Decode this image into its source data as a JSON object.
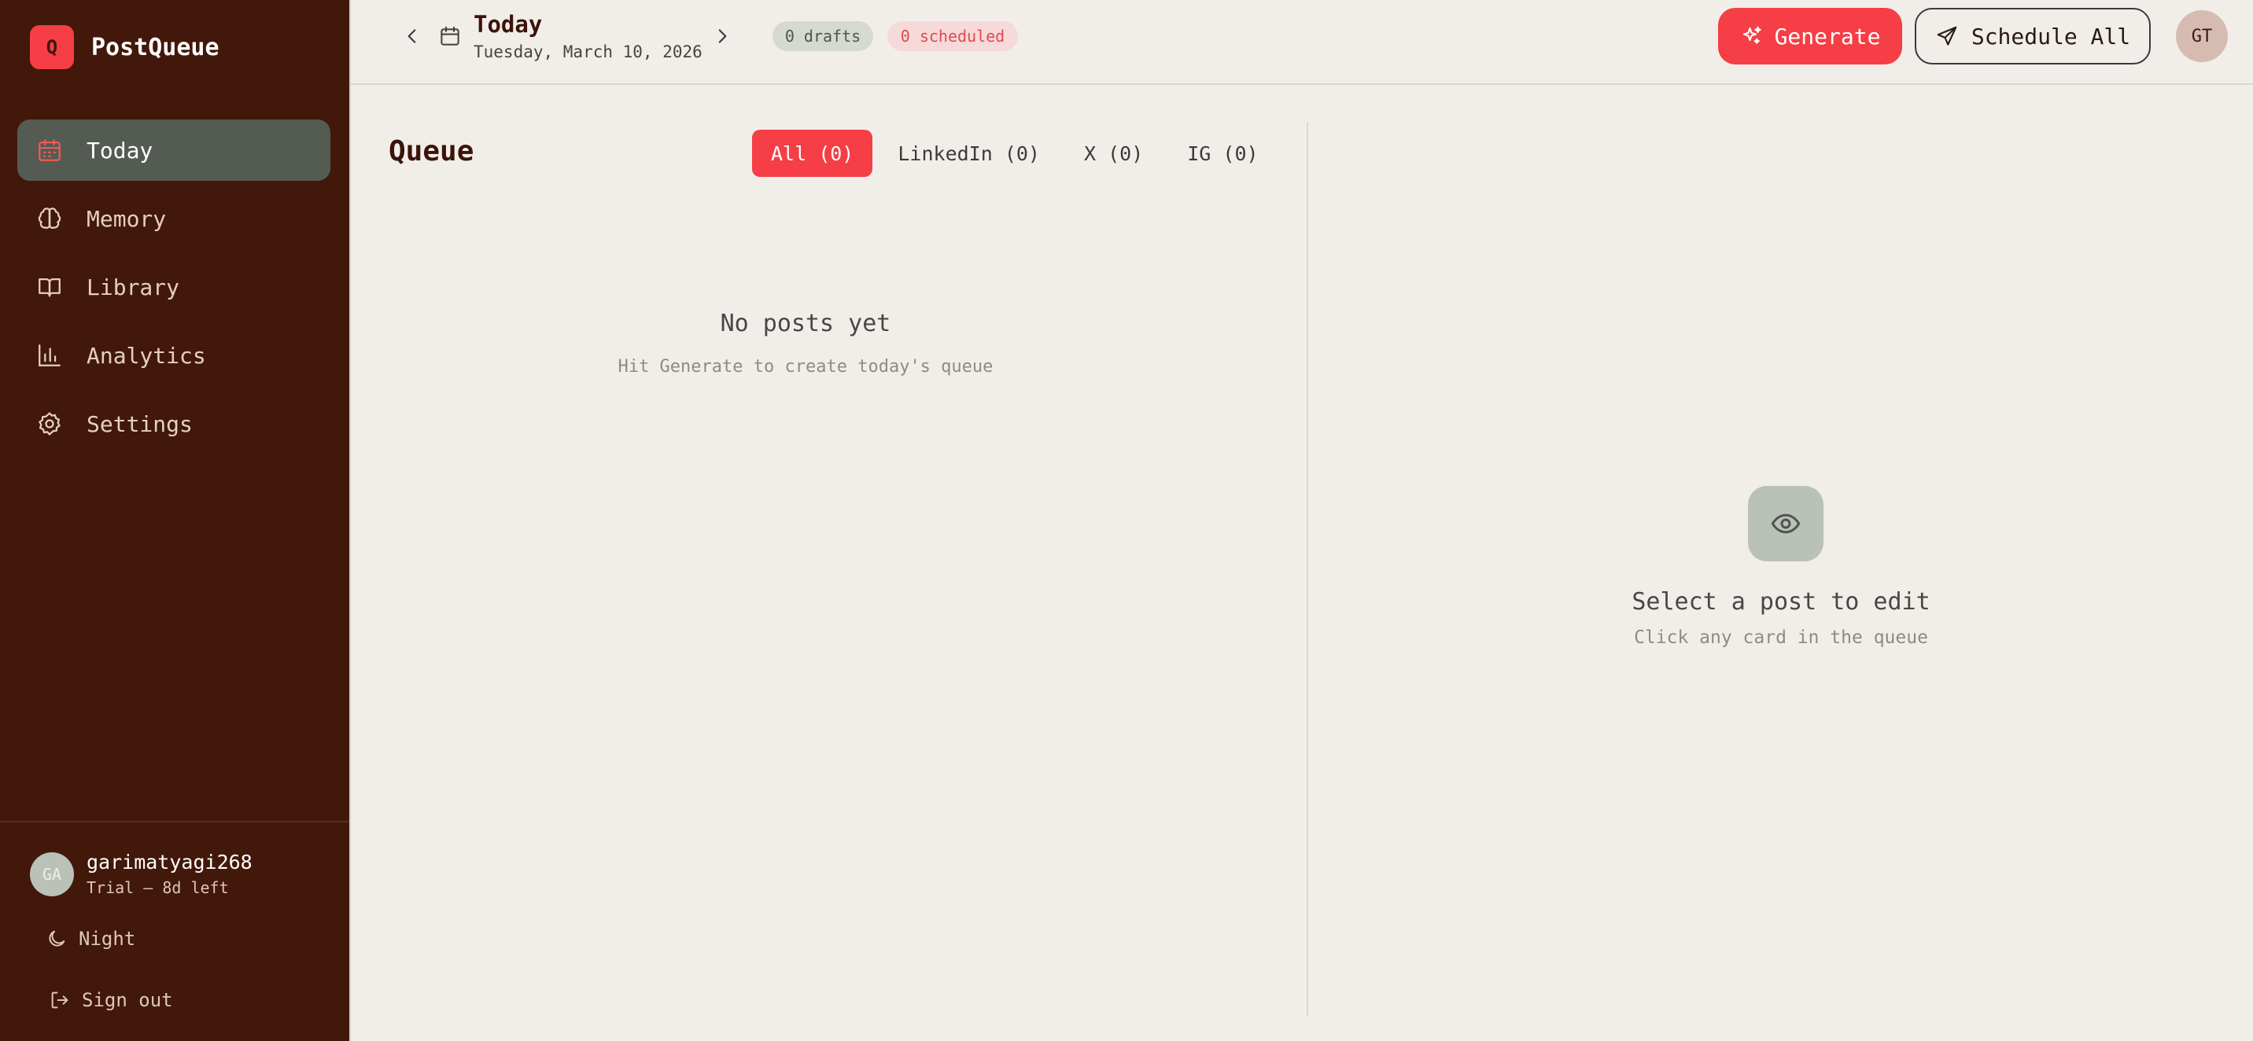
{
  "brand": {
    "logo_letter": "Q",
    "name": "PostQueue",
    "accent": "#f53e45"
  },
  "sidebar": {
    "items": [
      {
        "label": "Today",
        "icon": "calendar-icon",
        "active": true
      },
      {
        "label": "Memory",
        "icon": "brain-icon",
        "active": false
      },
      {
        "label": "Library",
        "icon": "book-icon",
        "active": false
      },
      {
        "label": "Analytics",
        "icon": "bar-chart-icon",
        "active": false
      },
      {
        "label": "Settings",
        "icon": "gear-icon",
        "active": false
      }
    ],
    "user": {
      "initials": "GA",
      "name": "garimatyagi268",
      "plan": "Trial — 8d left"
    },
    "theme_toggle": {
      "label": "Night",
      "icon": "moon-icon"
    },
    "sign_out": {
      "label": "Sign out",
      "icon": "logout-icon"
    }
  },
  "header": {
    "date_title": "Today",
    "date_subtitle": "Tuesday, March 10, 2026",
    "drafts_badge": "0 drafts",
    "scheduled_badge": "0 scheduled",
    "generate_label": "Generate",
    "schedule_all_label": "Schedule All",
    "avatar_initials": "GT"
  },
  "queue": {
    "title": "Queue",
    "tabs": [
      {
        "label": "All (0)",
        "active": true
      },
      {
        "label": "LinkedIn (0)",
        "active": false
      },
      {
        "label": "X (0)",
        "active": false
      },
      {
        "label": "IG (0)",
        "active": false
      }
    ],
    "empty_title": "No posts yet",
    "empty_subtitle": "Hit Generate to create today's queue"
  },
  "editor": {
    "empty_icon": "eye-icon",
    "empty_title": "Select a post to edit",
    "empty_subtitle": "Click any card in the queue"
  },
  "colors": {
    "sidebar_bg": "#42180a",
    "active_item_bg": "#545b52",
    "page_bg": "#f1eeea",
    "danger": "#f53e45"
  }
}
